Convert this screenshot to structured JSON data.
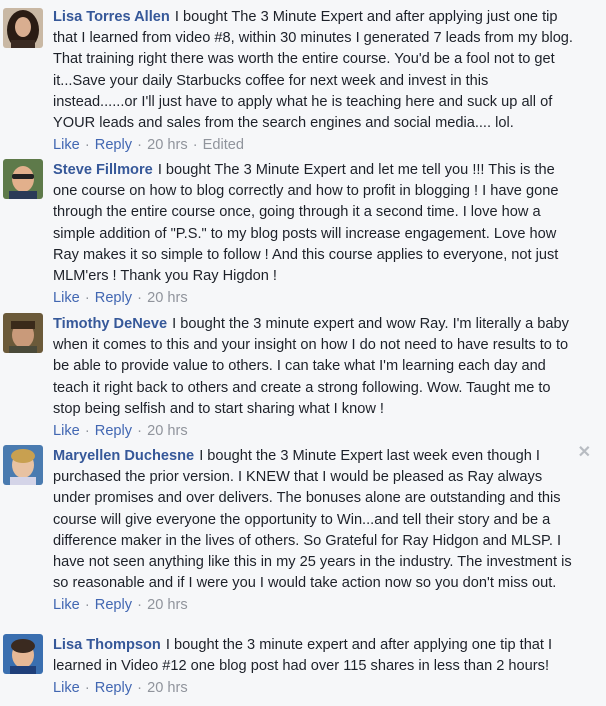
{
  "comments": [
    {
      "author": "Lisa Torres Allen",
      "text": "I bought The 3 Minute Expert and after applying just one tip that I learned from video #8, within 30 minutes I generated 7 leads from my blog. That training right there was worth the entire course. You'd be a fool not to get it...Save your daily Starbucks coffee for next week and invest in this instead......or I'll just have to apply what he is teaching here and suck up all of YOUR leads and sales from the search engines and social media.... lol.",
      "like": "Like",
      "reply": "Reply",
      "time": "20 hrs",
      "edited": "Edited"
    },
    {
      "author": "Steve Fillmore",
      "text": "I bought The 3 Minute Expert and let me tell you !!! This is the one course on how to blog correctly and how to profit in blogging ! I have gone through the entire course once, going through it a second time. I love how a simple addition of \"P.S.\" to my blog posts will increase engagement. Love how Ray makes it so simple to follow ! And this course applies to everyone, not just MLM'ers ! Thank you Ray Higdon !",
      "like": "Like",
      "reply": "Reply",
      "time": "20 hrs"
    },
    {
      "author": "Timothy DeNeve",
      "text": "I bought the 3 minute expert and wow Ray. I'm literally a baby when it comes to this and your insight on how I do not need to have results to to be able to provide value to others. I can take what I'm learning each day and teach it right back to others and create a strong following. Wow. Taught me to stop being selfish and to start sharing what I know !",
      "like": "Like",
      "reply": "Reply",
      "time": "20 hrs"
    },
    {
      "author": "Maryellen Duchesne",
      "text": "I bought the 3 Minute Expert last week even though I purchased the prior version. I KNEW that I would be pleased as Ray always under promises and over delivers. The bonuses alone are outstanding and this course will give everyone the opportunity to Win...and tell their story and be a difference maker in the lives of others. So Grateful for Ray Hidgon and MLSP. I have not seen anything like this in my 25 years in the industry. The investment is so reasonable and if I were you I would take action now so you don't miss out.",
      "like": "Like",
      "reply": "Reply",
      "time": "20 hrs",
      "close_glyph": "✕"
    },
    {
      "author": "Lisa Thompson",
      "text": "I bought the 3 minute expert and after applying one tip that I learned in Video #12 one blog post had over 115 shares in less than 2 hours!",
      "like": "Like",
      "reply": "Reply",
      "time": "20 hrs"
    }
  ],
  "separator": "·",
  "colors": {
    "author_link": "#365899",
    "action_link": "#4267b2",
    "meta_text": "#90949c",
    "background": "#f6f7f9"
  }
}
